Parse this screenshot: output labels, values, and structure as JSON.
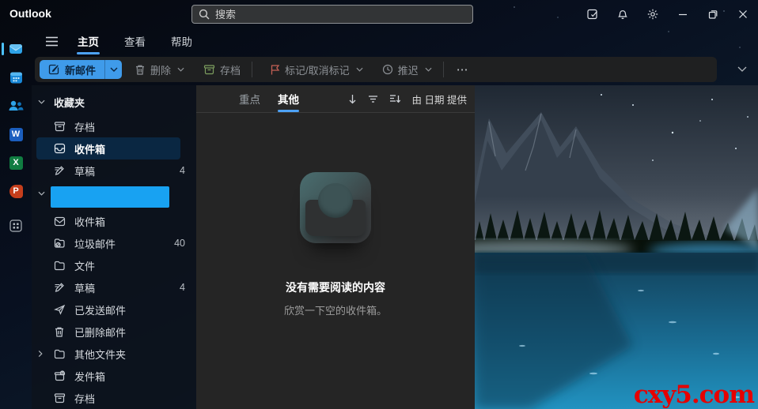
{
  "window": {
    "app_title": "Outlook"
  },
  "titlebar": {
    "search_placeholder": "搜索"
  },
  "rail": {
    "letters": {
      "word": "W",
      "excel": "X",
      "ppt": "P"
    }
  },
  "menubar": {
    "tabs": [
      {
        "label": "主页"
      },
      {
        "label": "查看"
      },
      {
        "label": "帮助"
      }
    ]
  },
  "toolbar": {
    "new_mail_label": "新邮件",
    "delete_label": "删除",
    "archive_label": "存档",
    "flag_label": "标记/取消标记",
    "snooze_label": "推迟",
    "more_label": "⋯"
  },
  "sidebar": {
    "favorites": {
      "header": "收藏夹",
      "items": [
        {
          "label": "存档"
        },
        {
          "label": "收件箱"
        },
        {
          "label": "草稿",
          "count": "4"
        }
      ]
    },
    "account": {
      "items": [
        {
          "label": "收件箱"
        },
        {
          "label": "垃圾邮件",
          "count": "40"
        },
        {
          "label": "文件"
        },
        {
          "label": "草稿",
          "count": "4"
        },
        {
          "label": "已发送邮件"
        },
        {
          "label": "已删除邮件"
        },
        {
          "label": "其他文件夹"
        },
        {
          "label": "发件箱"
        },
        {
          "label": "存档"
        }
      ]
    }
  },
  "list": {
    "tabs": [
      {
        "label": "重点"
      },
      {
        "label": "其他"
      }
    ],
    "sort_label": "由 日期 提供",
    "empty_title": "没有需要阅读的内容",
    "empty_subtitle": "欣赏一下空的收件箱。"
  },
  "watermark": "cxy5.com",
  "colors": {
    "accent": "#4da2f5",
    "new_mail_blue": "#3f9bea",
    "selected_row": "#0a2742",
    "account_block": "#18a2f2",
    "archive_icon_green": "#7d9f5f",
    "flag_icon_red": "#c35f55",
    "watermark_red": "#e60000"
  }
}
